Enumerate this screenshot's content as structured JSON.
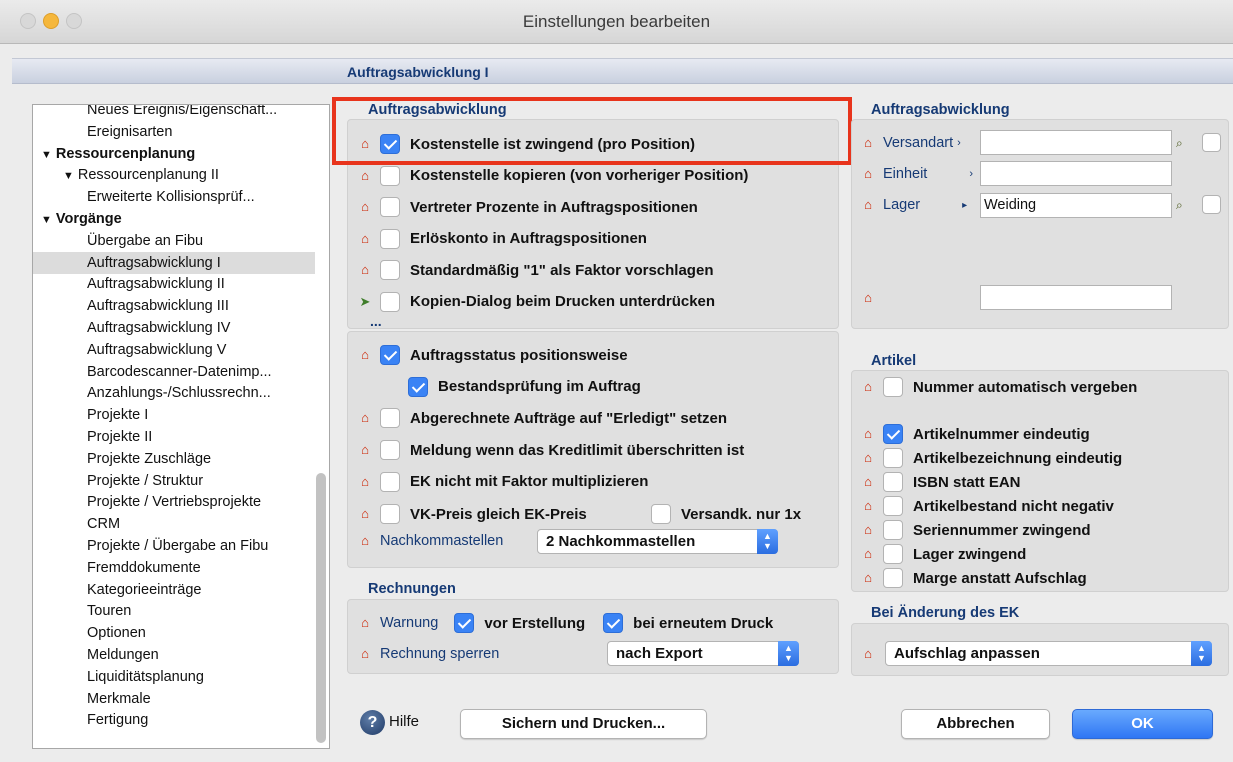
{
  "window": {
    "title": "Einstellungen bearbeiten"
  },
  "header": {
    "title": "Auftragsabwicklung I"
  },
  "tree": {
    "items": [
      {
        "label": "Neues Ereignis/Eigenschaft...",
        "level": 3
      },
      {
        "label": "Ereignisarten",
        "level": 3
      },
      {
        "label": "Ressourcenplanung",
        "level": 1,
        "bold": true,
        "expanded": true
      },
      {
        "label": "Ressourcenplanung II",
        "level": 2,
        "expanded": true
      },
      {
        "label": "Erweiterte Kollisionsprüf...",
        "level": 3
      },
      {
        "label": "Vorgänge",
        "level": 1,
        "bold": true,
        "expanded": true
      },
      {
        "label": "Übergabe an Fibu",
        "level": 3
      },
      {
        "label": "Auftragsabwicklung I",
        "level": 3,
        "selected": true
      },
      {
        "label": "Auftragsabwicklung II",
        "level": 3
      },
      {
        "label": "Auftragsabwicklung III",
        "level": 3
      },
      {
        "label": "Auftragsabwicklung IV",
        "level": 3
      },
      {
        "label": "Auftragsabwicklung V",
        "level": 3
      },
      {
        "label": "Barcodescanner-Datenimp...",
        "level": 3
      },
      {
        "label": "Anzahlungs-/Schlussrechn...",
        "level": 3
      },
      {
        "label": "Projekte I",
        "level": 3
      },
      {
        "label": "Projekte II",
        "level": 3
      },
      {
        "label": "Projekte Zuschläge",
        "level": 3
      },
      {
        "label": "Projekte / Struktur",
        "level": 3
      },
      {
        "label": "Projekte / Vertriebsprojekte",
        "level": 3
      },
      {
        "label": "CRM",
        "level": 3
      },
      {
        "label": "Projekte / Übergabe an Fibu",
        "level": 3
      },
      {
        "label": "Fremddokumente",
        "level": 3
      },
      {
        "label": "Kategorieeinträge",
        "level": 3
      },
      {
        "label": "Touren",
        "level": 3
      },
      {
        "label": "Optionen",
        "level": 3
      },
      {
        "label": "Meldungen",
        "level": 3
      },
      {
        "label": "Liquiditätsplanung",
        "level": 3
      },
      {
        "label": "Merkmale",
        "level": 3
      },
      {
        "label": "Fertigung",
        "level": 3
      }
    ]
  },
  "order_panel": {
    "heading": "Auftragsabwicklung",
    "options_a": [
      {
        "label": "Kostenstelle ist zwingend (pro Position)",
        "checked": true,
        "icon": "house-icon",
        "highlighted": true
      },
      {
        "label": "Kostenstelle kopieren (von vorheriger Position)",
        "checked": false,
        "icon": "house-icon"
      },
      {
        "label": "Vertreter Prozente in Auftragspositionen",
        "checked": false,
        "icon": "house-icon"
      },
      {
        "label": "Erlöskonto in Auftragspositionen",
        "checked": false,
        "icon": "house-icon"
      },
      {
        "label": "Standardmäßig \"1\" als Faktor vorschlagen",
        "checked": false,
        "icon": "house-icon"
      },
      {
        "label": "Kopien-Dialog beim Drucken unterdrücken",
        "checked": false,
        "icon": "user-arrow-icon"
      }
    ],
    "more": "...",
    "options_b": [
      {
        "label": "Auftragsstatus positionsweise",
        "checked": true
      },
      {
        "label": "Bestandsprüfung im Auftrag",
        "checked": true,
        "indent": true
      },
      {
        "label": "Abgerechnete Aufträge auf \"Erledigt\" setzen",
        "checked": false
      },
      {
        "label": "Meldung wenn das Kreditlimit überschritten ist",
        "checked": false
      },
      {
        "label": "EK nicht mit Faktor multiplizieren",
        "checked": false
      }
    ],
    "vk_label": "VK-Preis gleich EK-Preis",
    "vk_checked": false,
    "versand_label": "Versandk. nur 1x",
    "versand_checked": false,
    "decimals_label": "Nachkommastellen",
    "decimals_value": "2 Nachkommastellen"
  },
  "invoice_panel": {
    "heading": "Rechnungen",
    "warning_label": "Warnung",
    "before_label": "vor Erstellung",
    "before_checked": true,
    "reprint_label": "bei erneutem Druck",
    "reprint_checked": true,
    "lock_label": "Rechnung sperren",
    "lock_value": "nach Export"
  },
  "right_panel": {
    "heading": "Auftragsabwicklung",
    "versandart_label": "Versandart",
    "versandart_value": "",
    "einheit_label": "Einheit",
    "einheit_value": "",
    "lager_label": "Lager",
    "lager_value": "Weiding",
    "extra_value": ""
  },
  "article_panel": {
    "heading": "Artikel",
    "options": [
      {
        "label": "Nummer automatisch vergeben",
        "checked": false
      },
      {
        "label": "Artikelnummer eindeutig",
        "checked": true
      },
      {
        "label": "Artikelbezeichnung eindeutig",
        "checked": false
      },
      {
        "label": "ISBN statt EAN",
        "checked": false
      },
      {
        "label": "Artikelbestand nicht negativ",
        "checked": false
      },
      {
        "label": "Seriennummer zwingend",
        "checked": false
      },
      {
        "label": "Lager zwingend",
        "checked": false
      },
      {
        "label": "Marge anstatt Aufschlag",
        "checked": false
      }
    ]
  },
  "ek_panel": {
    "heading": "Bei Änderung des EK",
    "value": "Aufschlag anpassen"
  },
  "footer": {
    "help_label": "Hilfe",
    "save_print_label": "Sichern und Drucken...",
    "cancel_label": "Abbrechen",
    "ok_label": "OK"
  },
  "colors": {
    "accent": "#3a83f5",
    "heading": "#163a75",
    "highlight_frame": "#e8341c",
    "house_icon": "#cc2200"
  }
}
